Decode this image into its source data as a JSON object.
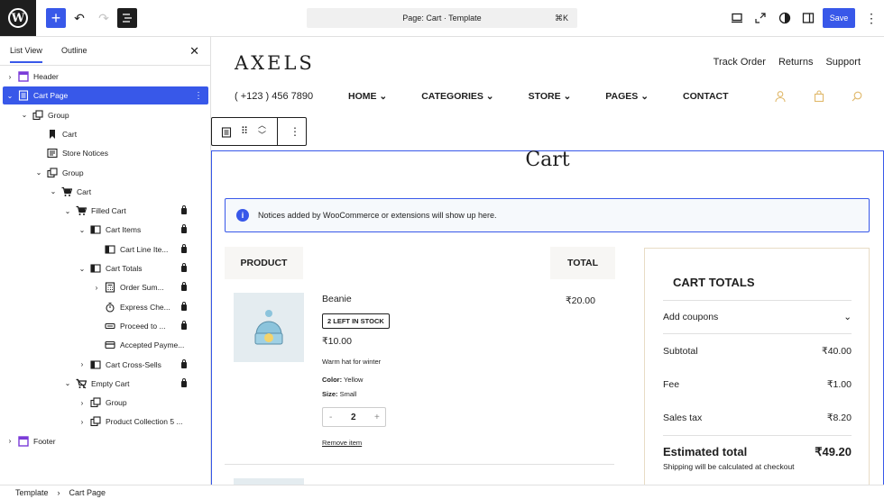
{
  "topbar": {
    "command_label": "Page: Cart · Template",
    "command_shortcut": "⌘K",
    "save_label": "Save"
  },
  "sidebar": {
    "tab_list_view": "List View",
    "tab_outline": "Outline",
    "tree": [
      {
        "label": "Header",
        "icon": "template-part-icon",
        "chev": "›"
      },
      {
        "label": "Cart Page",
        "icon": "post-content-icon",
        "chev": "⌄",
        "selected": true
      },
      {
        "label": "Group",
        "icon": "group-icon",
        "chev": "⌄"
      },
      {
        "label": "Cart",
        "icon": "bookmark-icon",
        "chev": ""
      },
      {
        "label": "Store Notices",
        "icon": "notices-icon",
        "chev": ""
      },
      {
        "label": "Group",
        "icon": "group-icon",
        "chev": "⌄"
      },
      {
        "label": "Cart",
        "icon": "cart-icon",
        "chev": "⌄"
      },
      {
        "label": "Filled Cart",
        "icon": "cart-icon",
        "chev": "⌄",
        "locked": true
      },
      {
        "label": "Cart Items",
        "icon": "columns-icon",
        "chev": "⌄",
        "locked": true
      },
      {
        "label": "Cart Line Ite...",
        "icon": "columns-icon",
        "chev": "",
        "locked": true
      },
      {
        "label": "Cart Totals",
        "icon": "columns-icon",
        "chev": "⌄",
        "locked": true
      },
      {
        "label": "Order Sum...",
        "icon": "calculator-icon",
        "chev": "›",
        "locked": true
      },
      {
        "label": "Express Che...",
        "icon": "stopwatch-icon",
        "chev": "",
        "locked": true
      },
      {
        "label": "Proceed to ...",
        "icon": "button-icon",
        "chev": "",
        "locked": true
      },
      {
        "label": "Accepted Payme...",
        "icon": "card-icon",
        "chev": ""
      },
      {
        "label": "Cart Cross-Sells",
        "icon": "columns-icon",
        "chev": "›",
        "locked": true
      },
      {
        "label": "Empty Cart",
        "icon": "cart-empty-icon",
        "chev": "⌄",
        "locked": true
      },
      {
        "label": "Group",
        "icon": "group-icon",
        "chev": "›"
      },
      {
        "label": "Product Collection 5 ...",
        "icon": "group-icon",
        "chev": "›"
      },
      {
        "label": "Footer",
        "icon": "template-part-icon",
        "chev": "›"
      }
    ]
  },
  "site": {
    "logo": "AXELS",
    "top_links": [
      "Track Order",
      "Returns",
      "Support"
    ],
    "phone": "( +123 ) 456 7890",
    "nav": [
      "HOME ⌄",
      "CATEGORIES ⌄",
      "STORE ⌄",
      "PAGES ⌄",
      "CONTACT"
    ]
  },
  "cart": {
    "title": "Cart",
    "notice": "Notices added by WooCommerce or extensions will show up here.",
    "col_product": "PRODUCT",
    "col_total": "TOTAL",
    "item": {
      "name": "Beanie",
      "stock": "2 LEFT IN STOCK",
      "price": "₹10.00",
      "description": "Warm hat for winter",
      "color_label": "Color:",
      "color_value": "Yellow",
      "size_label": "Size:",
      "size_value": "Small",
      "quantity": "2",
      "minus": "-",
      "plus": "+",
      "remove": "Remove item",
      "line_total": "₹20.00"
    }
  },
  "totals": {
    "title": "CART TOTALS",
    "coupons": "Add coupons",
    "subtotal_label": "Subtotal",
    "subtotal_value": "₹40.00",
    "fee_label": "Fee",
    "fee_value": "₹1.00",
    "tax_label": "Sales tax",
    "tax_value": "₹8.20",
    "estimated_label": "Estimated total",
    "estimated_value": "₹49.20",
    "shipping_note": "Shipping will be calculated at checkout"
  },
  "breadcrumb": {
    "root": "Template",
    "separator": "›",
    "current": "Cart Page"
  },
  "colors": {
    "accent": "#3858e9",
    "dark": "#1e1e1e",
    "header_icon": "#e0b86a"
  }
}
